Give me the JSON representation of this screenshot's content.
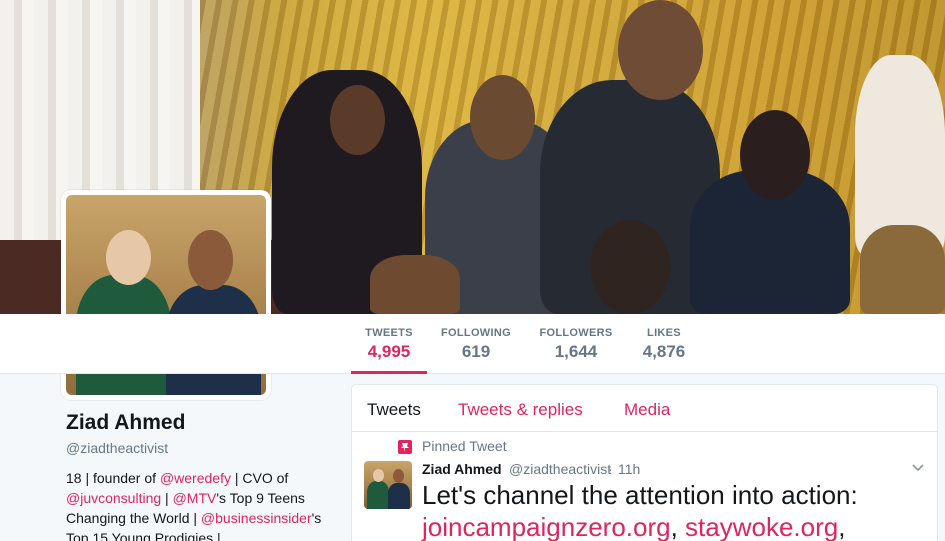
{
  "profile": {
    "name": "Ziad Ahmed",
    "handle": "@ziadtheactivist",
    "bio": {
      "part1": "18 | founder of ",
      "link1": "@weredefy",
      "part2": " | CVO of ",
      "link2": "@juvconsulting",
      "part3": " | ",
      "link3": "@MTV",
      "part4": "'s Top 9 Teens Changing the World | ",
      "link4": "@businessinsider",
      "part5": "'s Top 15 Young Prodigies |"
    }
  },
  "stats": [
    {
      "label": "TWEETS",
      "value": "4,995"
    },
    {
      "label": "FOLLOWING",
      "value": "619"
    },
    {
      "label": "FOLLOWERS",
      "value": "1,644"
    },
    {
      "label": "LIKES",
      "value": "4,876"
    }
  ],
  "tabs": [
    {
      "label": "Tweets"
    },
    {
      "label": "Tweets & replies"
    },
    {
      "label": "Media"
    }
  ],
  "pinned": {
    "label": "Pinned Tweet",
    "icon": "pin-icon"
  },
  "tweet": {
    "name": "Ziad Ahmed",
    "handle": "@ziadtheactivist",
    "dot": "·",
    "time": "11h",
    "text_start": "Let's channel the attention into action: ",
    "link1": "joincampaignzero.org",
    "sep": ", ",
    "link2": "staywoke.org",
    "text_end": ","
  },
  "colors": {
    "accent": "#e0245e",
    "muted": "#657786",
    "text": "#14171a",
    "border": "#e1e8ed",
    "background": "#f5f8fa"
  }
}
